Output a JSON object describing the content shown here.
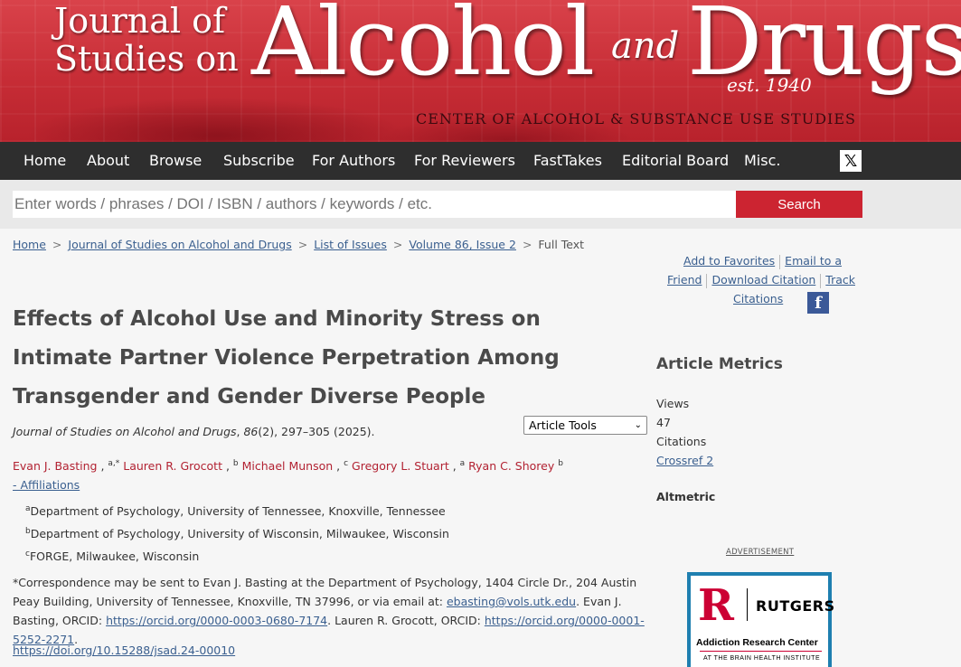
{
  "banner": {
    "line1": "Journal of",
    "line2": "Studies on",
    "word1": "Alcohol",
    "and": "and",
    "word2": "Drugs",
    "est": "est. 1940",
    "center": "CENTER OF ALCOHOL & SUBSTANCE USE STUDIES"
  },
  "nav": {
    "items": [
      "Home",
      "About",
      "Browse",
      "Subscribe",
      "For Authors",
      "For Reviewers",
      "FastTakes",
      "Editorial Board",
      "Misc."
    ],
    "facebook_glyph": "f",
    "x_glyph": "𝕏"
  },
  "search": {
    "placeholder": "Enter words / phrases / DOI / ISBN / authors / keywords / etc.",
    "button": "Search"
  },
  "breadcrumb": {
    "items": [
      "Home",
      "Journal of Studies on Alcohol and Drugs",
      "List of Issues",
      "Volume 86, Issue 2"
    ],
    "current": "Full Text",
    "sep": ">"
  },
  "tools": {
    "add_favorites": "Add to Favorites",
    "email_friend_1": "Email to a",
    "email_friend_2": "Friend",
    "download_citation": "Download Citation",
    "track_1": "Track",
    "track_2": "Citations"
  },
  "article": {
    "title": "Effects of Alcohol Use and Minority Stress on Intimate Partner Violence Perpetration Among Transgender and Gender Diverse People",
    "journal": "Journal of Studies on Alcohol and Drugs",
    "volume": "86",
    "citation_rest": "(2), 297–305 (2025).",
    "article_tools_label": "Article Tools",
    "authors": [
      {
        "name": "Evan J. Basting",
        "sup": "a,*"
      },
      {
        "name": "Lauren R. Grocott",
        "sup": "b"
      },
      {
        "name": "Michael Munson",
        "sup": "c"
      },
      {
        "name": "Gregory L. Stuart",
        "sup": "a"
      },
      {
        "name": "Ryan C. Shorey",
        "sup": "b"
      }
    ],
    "affiliations_toggle": "- Affiliations",
    "affiliations": [
      {
        "sup": "a",
        "text": "Department of Psychology, University of Tennessee, Knoxville, Tennessee"
      },
      {
        "sup": "b",
        "text": "Department of Psychology, University of Wisconsin, Milwaukee, Wisconsin"
      },
      {
        "sup": "c",
        "text": "FORGE, Milwaukee, Wisconsin"
      }
    ],
    "correspondence_1": "*Correspondence may be sent to Evan J. Basting at the Department of Psychology, 1404 Circle Dr., 204 Austin Peay Building, University of Tennessee, Knoxville, TN 37996, or via email at: ",
    "email": "ebasting@vols.utk.edu",
    "correspondence_2": ". Evan J. Basting, ORCID: ",
    "orcid1": "https://orcid.org/0000-0003-0680-7174",
    "correspondence_3": ". Lauren R. Grocott, ORCID: ",
    "orcid2": "https://orcid.org/0000-0001-5252-2271",
    "correspondence_4": ".",
    "doi": "https://doi.org/10.15288/jsad.24-00010"
  },
  "metrics": {
    "heading": "Article Metrics",
    "views_label": "Views",
    "views_value": "47",
    "citations_label": "Citations",
    "crossref": "Crossref 2",
    "altmetric": "Altmetric"
  },
  "ad": {
    "label": "ADVERTISEMENT",
    "logo_letter": "R",
    "brand": "RUTGERS",
    "center": "Addiction Research Center",
    "sub": "AT THE BRAIN HEALTH INSTITUTE"
  },
  "colors": {
    "brand_red": "#cc2431",
    "nav_bg": "#2e2e2e",
    "link": "#3a5f8f",
    "author": "#b22232"
  }
}
